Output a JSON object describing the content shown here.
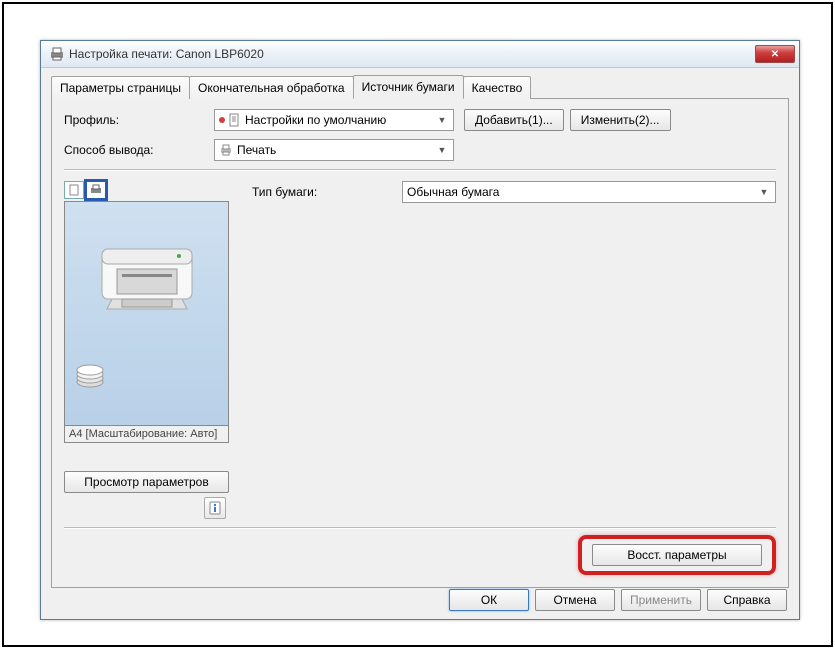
{
  "window": {
    "title": "Настройка печати: Canon LBP6020"
  },
  "tabs": [
    "Параметры страницы",
    "Окончательная обработка",
    "Источник бумаги",
    "Качество"
  ],
  "form": {
    "profile_label": "Профиль:",
    "profile_value": "Настройки по умолчанию",
    "add_btn": "Добавить(1)...",
    "edit_btn": "Изменить(2)...",
    "output_label": "Способ вывода:",
    "output_value": "Печать",
    "paper_type_label": "Тип бумаги:",
    "paper_type_value": "Обычная бумага",
    "restore_btn": "Восст. параметры"
  },
  "preview": {
    "caption": "A4 [Масштабирование: Авто]",
    "view_params_btn": "Просмотр параметров"
  },
  "buttons": {
    "ok": "ОК",
    "cancel": "Отмена",
    "apply": "Применить",
    "help": "Справка"
  }
}
